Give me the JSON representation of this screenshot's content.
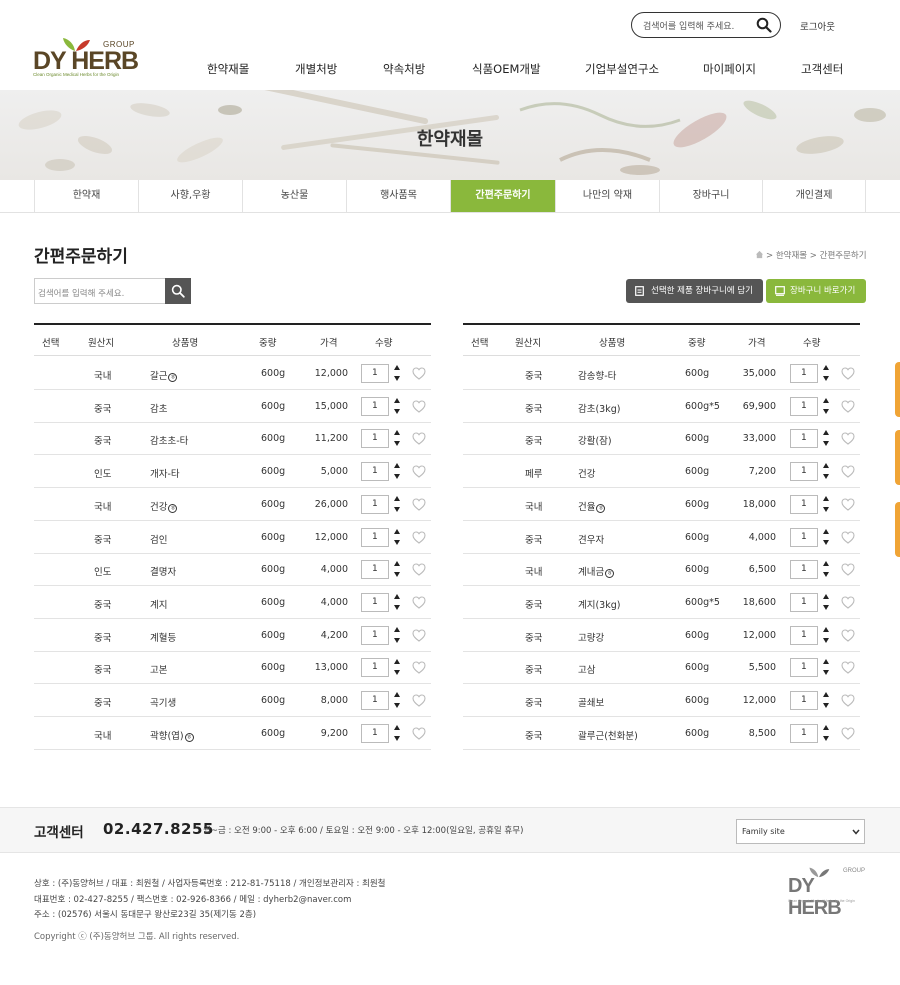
{
  "header": {
    "logo_text": "DY HERB",
    "logo_group": "GROUP",
    "logo_tagline": "Clean Organic Medical Herbs for the Origin",
    "search_placeholder": "검색어를 입력해 주세요.",
    "logout": "로그아웃",
    "nav": [
      "한약재몰",
      "개별처방",
      "약속처방",
      "식품OEM개발",
      "기업부설연구소",
      "마이페이지",
      "고객센터"
    ]
  },
  "banner": {
    "title": "한약재몰"
  },
  "subnav": {
    "tabs": [
      "한약재",
      "사향,우황",
      "농산물",
      "행사품목",
      "간편주문하기",
      "나만의 약재",
      "장바구니",
      "개인결제"
    ],
    "active_index": 4
  },
  "page": {
    "title": "간편주문하기",
    "breadcrumb": "> 한약재몰 > 간편주문하기",
    "search_placeholder": "검색어를 입력해 주세요.",
    "btn_add_cart": "선택한 제품 장바구니에 담기",
    "btn_go_cart": "장바구니 바로가기"
  },
  "table": {
    "headers": [
      "선택",
      "원산지",
      "상품명",
      "중량",
      "가격",
      "수량"
    ],
    "left_rows": [
      {
        "origin": "국내",
        "name": "갈근",
        "mark": "ㅎ",
        "weight": "600g",
        "price": "12,000",
        "qty": "1"
      },
      {
        "origin": "중국",
        "name": "감초",
        "mark": "",
        "weight": "600g",
        "price": "15,000",
        "qty": "1"
      },
      {
        "origin": "중국",
        "name": "감초초-타",
        "mark": "",
        "weight": "600g",
        "price": "11,200",
        "qty": "1"
      },
      {
        "origin": "인도",
        "name": "개자-타",
        "mark": "",
        "weight": "600g",
        "price": "5,000",
        "qty": "1"
      },
      {
        "origin": "국내",
        "name": "건강",
        "mark": "ㅎ",
        "weight": "600g",
        "price": "26,000",
        "qty": "1"
      },
      {
        "origin": "중국",
        "name": "검인",
        "mark": "",
        "weight": "600g",
        "price": "12,000",
        "qty": "1"
      },
      {
        "origin": "인도",
        "name": "결명자",
        "mark": "",
        "weight": "600g",
        "price": "4,000",
        "qty": "1"
      },
      {
        "origin": "중국",
        "name": "계지",
        "mark": "",
        "weight": "600g",
        "price": "4,000",
        "qty": "1"
      },
      {
        "origin": "중국",
        "name": "계혈등",
        "mark": "",
        "weight": "600g",
        "price": "4,200",
        "qty": "1"
      },
      {
        "origin": "중국",
        "name": "고본",
        "mark": "",
        "weight": "600g",
        "price": "13,000",
        "qty": "1"
      },
      {
        "origin": "중국",
        "name": "곡기생",
        "mark": "",
        "weight": "600g",
        "price": "8,000",
        "qty": "1"
      },
      {
        "origin": "국내",
        "name": "곽향(엽)",
        "mark": "ㅎ",
        "weight": "600g",
        "price": "9,200",
        "qty": "1"
      }
    ],
    "right_rows": [
      {
        "origin": "중국",
        "name": "감송향-타",
        "mark": "",
        "weight": "600g",
        "price": "35,000",
        "qty": "1"
      },
      {
        "origin": "중국",
        "name": "감초(3kg)",
        "mark": "",
        "weight": "600g*5",
        "price": "69,900",
        "qty": "1"
      },
      {
        "origin": "중국",
        "name": "강활(잠)",
        "mark": "",
        "weight": "600g",
        "price": "33,000",
        "qty": "1"
      },
      {
        "origin": "페루",
        "name": "건강",
        "mark": "",
        "weight": "600g",
        "price": "7,200",
        "qty": "1"
      },
      {
        "origin": "국내",
        "name": "건율",
        "mark": "ㅎ",
        "weight": "600g",
        "price": "18,000",
        "qty": "1"
      },
      {
        "origin": "중국",
        "name": "견우자",
        "mark": "",
        "weight": "600g",
        "price": "4,000",
        "qty": "1"
      },
      {
        "origin": "국내",
        "name": "계내금",
        "mark": "ㅎ",
        "weight": "600g",
        "price": "6,500",
        "qty": "1"
      },
      {
        "origin": "중국",
        "name": "계지(3kg)",
        "mark": "",
        "weight": "600g*5",
        "price": "18,600",
        "qty": "1"
      },
      {
        "origin": "중국",
        "name": "고량강",
        "mark": "",
        "weight": "600g",
        "price": "12,000",
        "qty": "1"
      },
      {
        "origin": "중국",
        "name": "고삼",
        "mark": "",
        "weight": "600g",
        "price": "5,500",
        "qty": "1"
      },
      {
        "origin": "중국",
        "name": "골쇄보",
        "mark": "",
        "weight": "600g",
        "price": "12,000",
        "qty": "1"
      },
      {
        "origin": "중국",
        "name": "괄루근(천화분)",
        "mark": "",
        "weight": "600g",
        "price": "8,500",
        "qty": "1"
      }
    ]
  },
  "footer": {
    "cs_label": "고객센터",
    "tel": "02.427.8255",
    "hours": "월~금 : 오전 9:00 - 오후 6:00 / 토요일 : 오전 9:00 - 오후 12:00(일요일, 공휴일 휴무)",
    "family_site": "Family site",
    "info_lines": [
      "상호 : (주)동양허브 / 대표 : 최원철 / 사업자등록번호 : 212-81-75118 / 개인정보관리자 : 최원철",
      "대표번호 : 02-427-8255 / 팩스번호 : 02-926-8366 / 메일 : dyherb2@naver.com",
      "주소 : (02576) 서울시 동대문구 왕산로23길 35(제기동 2층)"
    ],
    "copyright": "Copyright ⓒ (주)동양허브 그룹. All rights reserved."
  },
  "colors": {
    "accent": "#8ab83c",
    "dark_button": "#555555",
    "side_tab": "#f0a435",
    "logo": "#5a4626"
  }
}
